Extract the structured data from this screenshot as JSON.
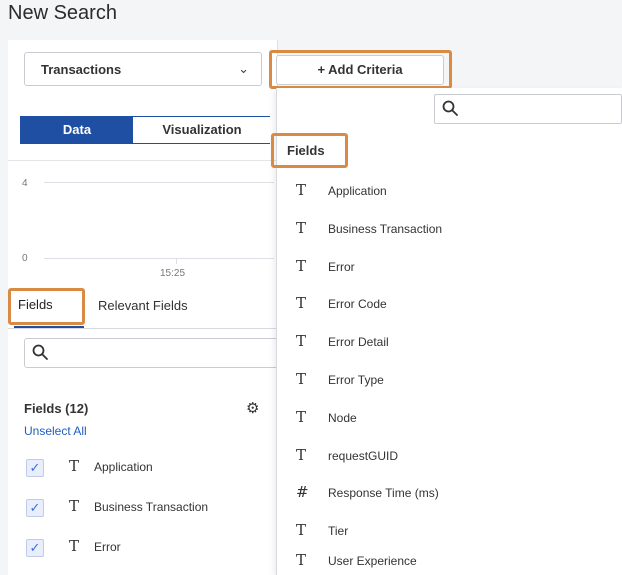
{
  "page": {
    "title": "New Search"
  },
  "source_select": {
    "value": "Transactions",
    "chevron": "chevron-down-icon"
  },
  "add_criteria": {
    "label": "+ Add Criteria"
  },
  "view_toggle": {
    "data_label": "Data",
    "visualization_label": "Visualization"
  },
  "mini_chart": {
    "y_top": "4",
    "y_bottom": "0",
    "x_label": "15:25"
  },
  "panel_tabs": {
    "fields": "Fields",
    "relevant_fields": "Relevant Fields"
  },
  "fields_panel": {
    "heading": "Fields (12)",
    "unselect_all": "Unselect All",
    "gear_icon": "gear-icon",
    "items": [
      {
        "icon": "T",
        "label": "Application",
        "checked": true
      },
      {
        "icon": "T",
        "label": "Business Transaction",
        "checked": true
      },
      {
        "icon": "T",
        "label": "Error",
        "checked": true
      }
    ]
  },
  "criteria_dropdown": {
    "heading": "Fields",
    "items": [
      {
        "icon": "T",
        "label": "Application"
      },
      {
        "icon": "T",
        "label": "Business Transaction"
      },
      {
        "icon": "T",
        "label": "Error"
      },
      {
        "icon": "T",
        "label": "Error Code"
      },
      {
        "icon": "T",
        "label": "Error Detail"
      },
      {
        "icon": "T",
        "label": "Error Type"
      },
      {
        "icon": "T",
        "label": "Node"
      },
      {
        "icon": "T",
        "label": "requestGUID"
      },
      {
        "icon": "#",
        "label": "Response Time (ms)"
      },
      {
        "icon": "T",
        "label": "Tier"
      },
      {
        "icon": "T",
        "label": "User Experience"
      }
    ]
  },
  "colors": {
    "accent": "#1f4fa3",
    "highlight": "#d98a45",
    "link": "#1f5fbf"
  }
}
